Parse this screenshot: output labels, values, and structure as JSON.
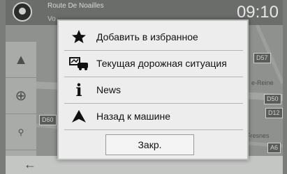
{
  "background": {
    "street_name": "Route De Noailles",
    "street_sub": "Vo",
    "clock": "09:10",
    "road_signs": [
      "D57",
      "D50",
      "D60",
      "D12",
      "A6"
    ],
    "map_labels": [
      "e-Reine",
      "Fresnes"
    ]
  },
  "dialog": {
    "items": [
      {
        "label": "Добавить в избранное",
        "icon": "star-icon"
      },
      {
        "label": "Текущая дорожная ситуация",
        "icon": "traffic-icon"
      },
      {
        "label": "News",
        "icon": "info-icon"
      },
      {
        "label": "Назад к машине",
        "icon": "navigation-arrow-icon"
      }
    ],
    "close_label": "Закр."
  },
  "colors": {
    "dialog_bg": "#ededed",
    "map_bg": "#8f918f",
    "icon": "#111111"
  }
}
